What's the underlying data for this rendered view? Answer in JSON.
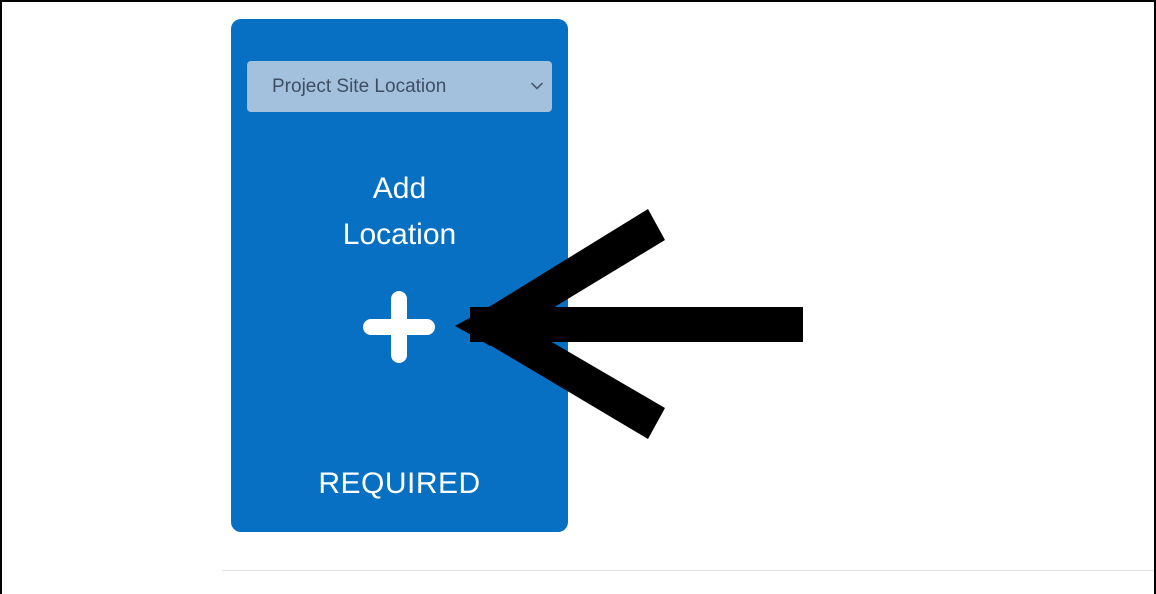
{
  "card": {
    "select": {
      "value": "Project Site Location",
      "icon": "chevron-down-icon"
    },
    "add_location": {
      "line1": "Add",
      "line2": "Location"
    },
    "add_button_icon": "plus-icon",
    "required_label": "REQUIRED"
  },
  "annotation": {
    "icon": "arrow-left-icon",
    "color": "#000000"
  },
  "colors": {
    "card_background": "#0770c2",
    "select_background": "#a3c0dc",
    "select_text": "#3f4e63",
    "foreground": "#ffffff"
  }
}
